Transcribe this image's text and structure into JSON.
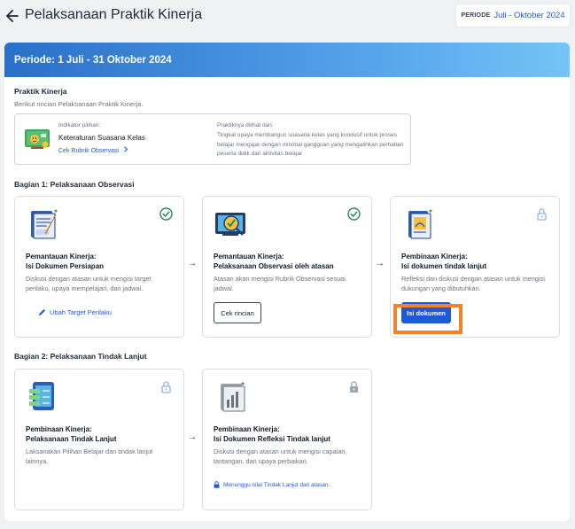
{
  "header": {
    "title": "Pelaksanaan Praktik Kinerja",
    "period_label": "PERIODE",
    "period_value": "Juli - Oktober 2024"
  },
  "banner": {
    "text": "Periode: 1 Juli - 31 Oktober 2024"
  },
  "practice": {
    "title": "Praktik Kinerja",
    "subtitle": "Berikut rincian Pelaksanaan Praktik Kinerja.",
    "indicator_caption": "Indikator pilihan:",
    "indicator_name": "Keteraturan Suasana Kelas",
    "rubric_link": "Cek Rubrik Observasi",
    "seen_from_caption": "Praktiknya dilihat dari:",
    "seen_from_text": "Tingkat upaya membangun suasana kelas yang kondusif untuk proses belajar mengajar dengan minimal gangguan yang mengalihkan perhatian peserta didik dari aktivitas belajar"
  },
  "part1": {
    "title": "Bagian 1: Pelaksanaan Observasi",
    "cards": [
      {
        "title_line1": "Pemantauan Kinerja:",
        "title_line2": "Isi Dokumen Persiapan",
        "description": "Diskusi dengan atasan untuk mengisi target perilaku, upaya mempelajari, dan jadwal.",
        "action_label": "Ubah Target Perilaku",
        "status": "completed"
      },
      {
        "title_line1": "Pemantauan Kinerja:",
        "title_line2": "Pelaksanaan Observasi oleh atasan",
        "description": "Atasan akan mengisi Rubrik Observasi sesuai jadwal.",
        "action_label": "Cek rincian",
        "status": "completed"
      },
      {
        "title_line1": "Pembinaan Kinerja:",
        "title_line2": "Isi dokumen tindak lanjut",
        "description": "Refleksi dan diskusi dengan atasan untuk mengisi dukungan yang dibutuhkan.",
        "action_label": "Isi dokumen",
        "status": "unlocked"
      }
    ]
  },
  "part2": {
    "title": "Bagian 2: Pelaksanaan Tindak Lanjut",
    "cards": [
      {
        "title_line1": "Pembinaan Kinerja:",
        "title_line2": "Pelaksanaan Tindak Lanjut",
        "description": "Laksanakan Pilihan Belajar dan tindak lanjut lainnya.",
        "status": "locked"
      },
      {
        "title_line1": "Pembinaan Kinerja:",
        "title_line2": "Isi Dokumen Refleksi Tindak lanjut",
        "description": "Diskusi dengan atasan untuk mengisi capaian, tantangan, dan upaya perbaikan.",
        "waiting_text": "Menunggu nilai Tindak Lanjut dari atasan.",
        "status": "locked"
      }
    ]
  },
  "colors": {
    "accent": "#1d5bd6",
    "success": "#2f855a",
    "highlight": "#f4822a"
  }
}
